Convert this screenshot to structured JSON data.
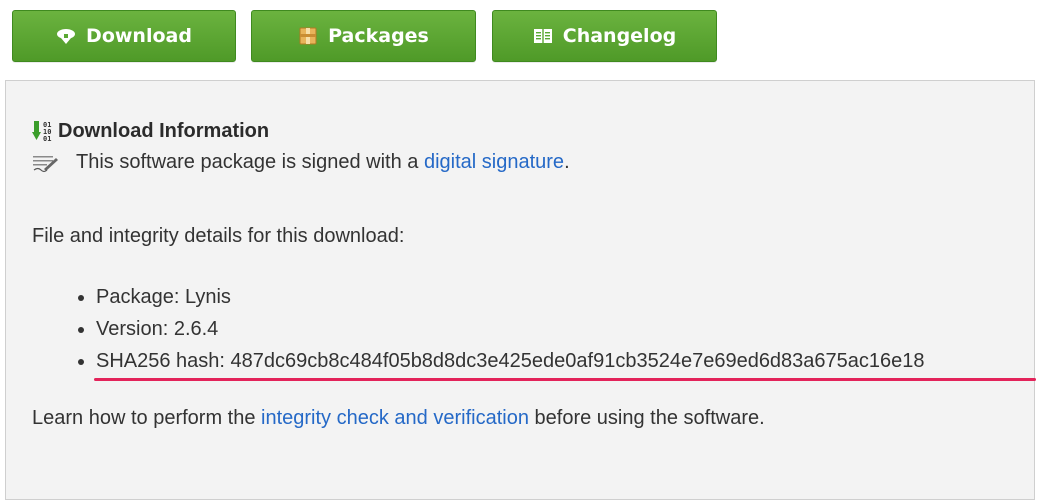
{
  "toolbar": {
    "download_label": "Download",
    "packages_label": "Packages",
    "changelog_label": "Changelog",
    "button_color": "#5aa832"
  },
  "info": {
    "title": "Download Information",
    "signature_text": "This software package is signed with a",
    "signature_link": "digital signature",
    "signature_end": ".",
    "details_intro": "File and integrity details for this download:",
    "items": [
      "Package: Lynis",
      "Version: 2.6.4",
      "SHA256 hash: 487dc69cb8c484f05b8d8dc3e425ede0af91cb3524e7e69ed6d83a675ac16e18"
    ],
    "learn_prefix": "Learn how to perform the",
    "learn_link": "integrity check and verification",
    "learn_suffix": "before using the software."
  },
  "icons": {
    "download": "cloud-download-icon",
    "packages": "package-icon",
    "changelog": "book-icon",
    "info": "binary-download-icon",
    "signature": "signature-pen-icon"
  },
  "colors": {
    "link": "#2569c7",
    "highlight_underline": "#e3235a",
    "panel_bg": "#f3f3f3"
  }
}
